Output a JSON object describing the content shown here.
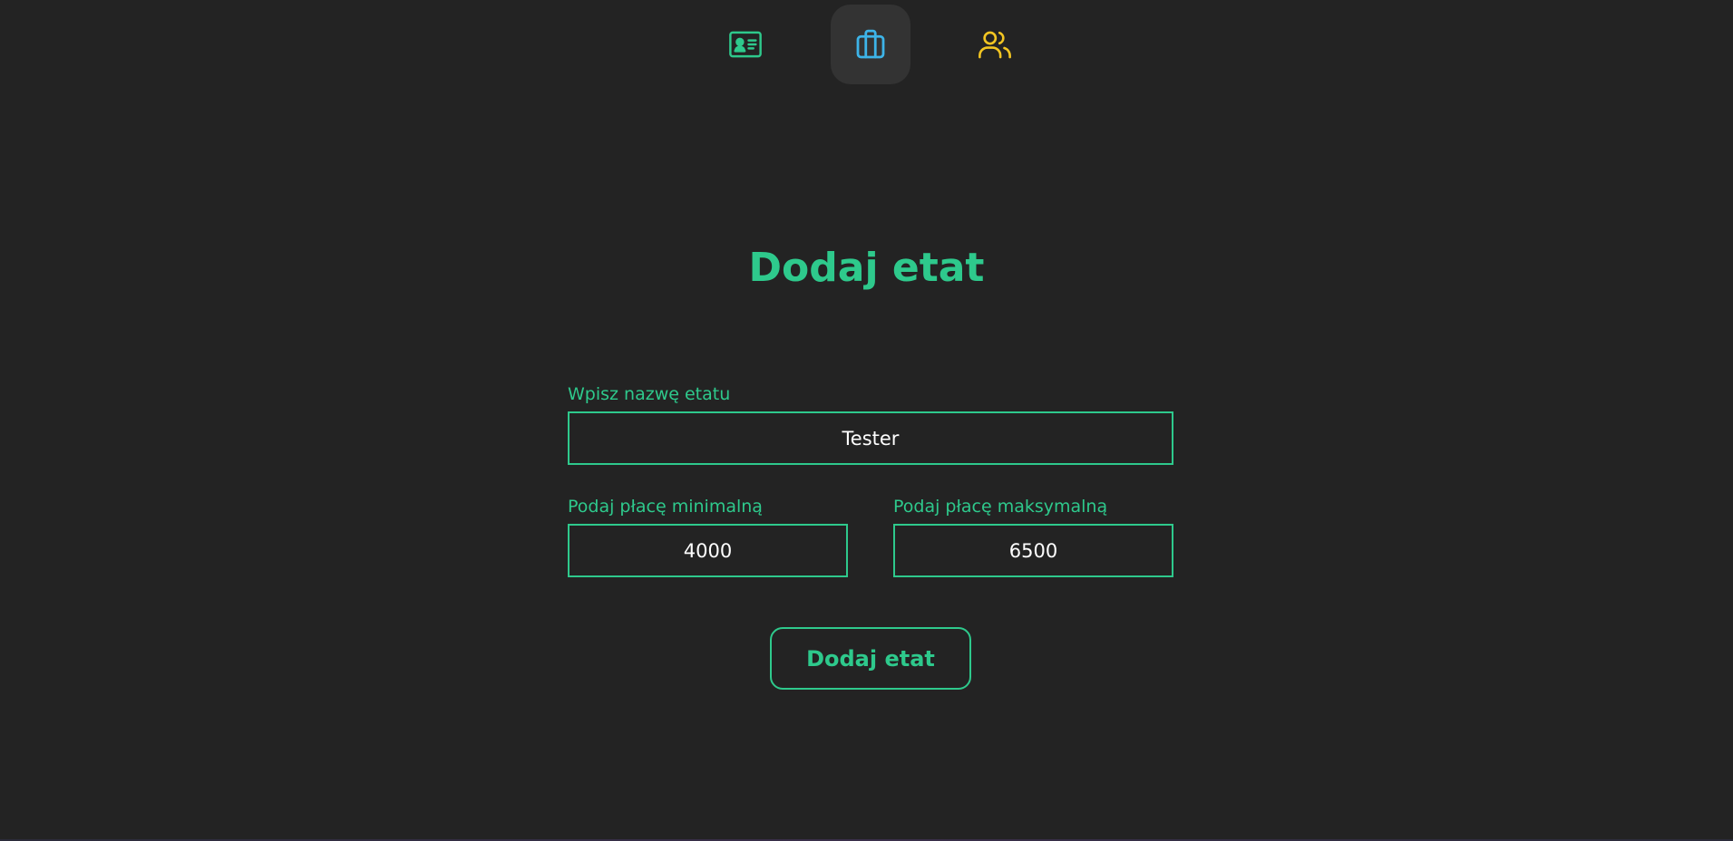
{
  "nav": {
    "items": [
      {
        "icon": "id-card-icon",
        "color": "#2ec98c",
        "active": false
      },
      {
        "icon": "briefcase-icon",
        "color": "#3db4e8",
        "active": true
      },
      {
        "icon": "users-icon",
        "color": "#f2c522",
        "active": false
      }
    ]
  },
  "page": {
    "title": "Dodaj etat"
  },
  "form": {
    "name_label": "Wpisz nazwę etatu",
    "name_value": "Tester",
    "min_label": "Podaj płacę minimalną",
    "min_value": "4000",
    "max_label": "Podaj płacę maksymalną",
    "max_value": "6500",
    "submit_label": "Dodaj etat"
  },
  "colors": {
    "accent": "#2ec98c",
    "background": "#232323",
    "active_nav_bg": "#333333"
  }
}
